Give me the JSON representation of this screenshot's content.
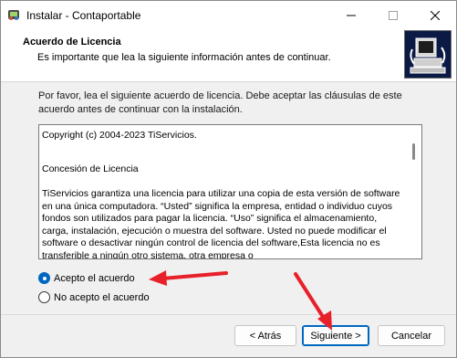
{
  "window": {
    "title": "Instalar - Contaportable",
    "minimize_glyph": "—",
    "maximize_glyph": "☐",
    "close_glyph": "✕"
  },
  "header": {
    "title": "Acuerdo de Licencia",
    "subtitle": "Es importante que lea la siguiente información antes de continuar."
  },
  "intro": "Por favor, lea el siguiente acuerdo de licencia. Debe aceptar las cláusulas de este acuerdo antes de continuar con la instalación.",
  "license": {
    "copyright": "Copyright (c) 2004-2023 TiServicios.",
    "heading": "Concesión de Licencia",
    "body": "TiServicios garantiza una licencia para utilizar una copia de esta versión de software en una única computadora. “Usted” significa la empresa, entidad o individuo cuyos fondos son utilizados para pagar la licencia. “Uso” significa el almacenamiento, carga, instalación, ejecución o muestra del software. Usted no puede modificar el software o desactivar ningún control de licencia del software,Esta licencia no es transferible a ningún otro sistema, otra empresa o"
  },
  "radios": {
    "accept": "Acepto el acuerdo",
    "decline": "No acepto el acuerdo",
    "selected": "accept"
  },
  "buttons": {
    "back": "< Atrás",
    "next": "Siguiente >",
    "cancel": "Cancelar"
  },
  "colors": {
    "accent": "#0067c0",
    "annotation_arrow": "#e8202a",
    "header_image_bg": "#0b1a45"
  },
  "icons": {
    "app": "installer-app-icon",
    "header_image": "computer-setup-icon"
  }
}
